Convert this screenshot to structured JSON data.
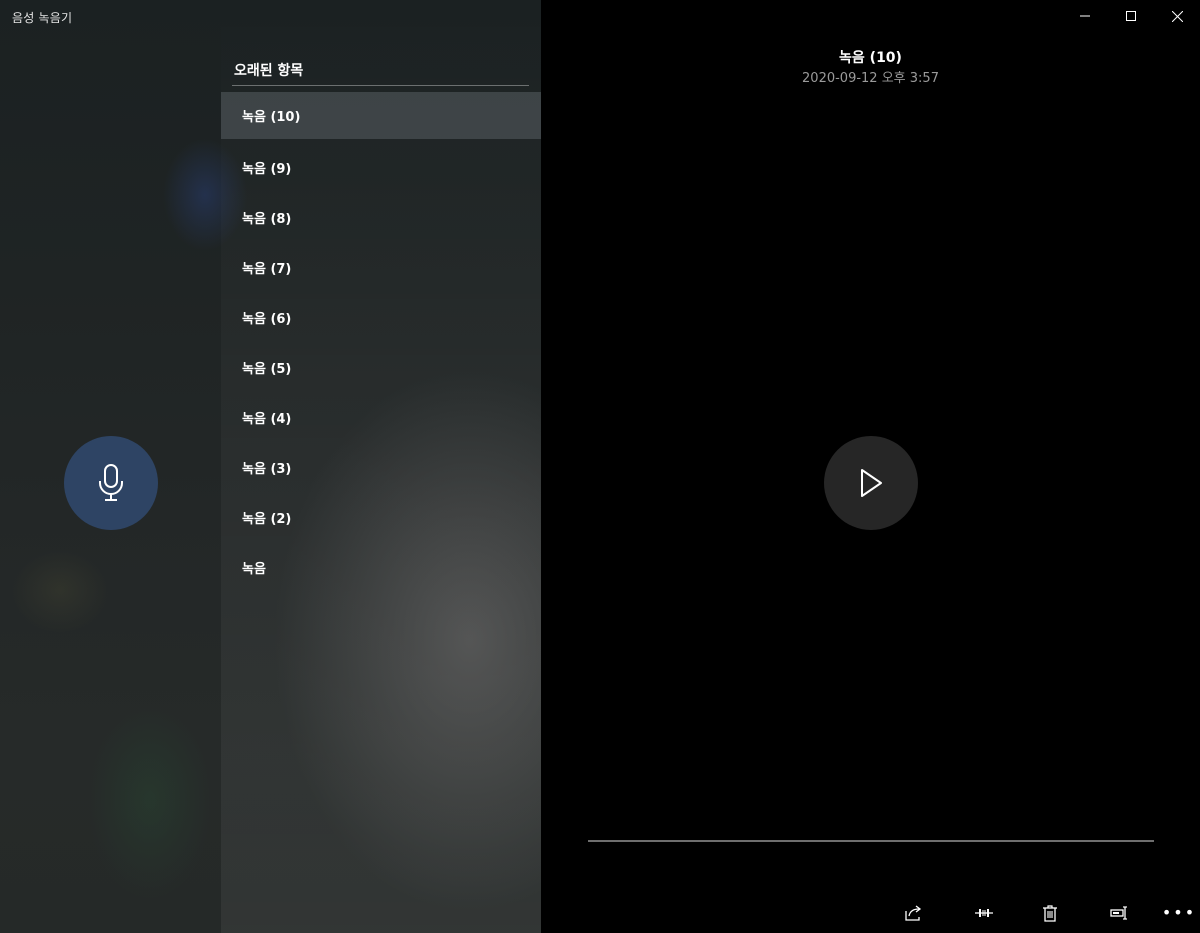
{
  "app": {
    "title": "음성 녹음기"
  },
  "list": {
    "header": "오래된 항목",
    "items": [
      {
        "label": "녹음 (10)",
        "selected": true
      },
      {
        "label": "녹음 (9)"
      },
      {
        "label": "녹음 (8)"
      },
      {
        "label": "녹음 (7)"
      },
      {
        "label": "녹음 (6)"
      },
      {
        "label": "녹음 (5)"
      },
      {
        "label": "녹음 (4)"
      },
      {
        "label": "녹음 (3)"
      },
      {
        "label": "녹음 (2)"
      },
      {
        "label": "녹음"
      }
    ]
  },
  "detail": {
    "title": "녹음 (10)",
    "date": "2020-09-12 오후 3:57"
  },
  "icons": {
    "record": "microphone-icon",
    "play": "play-icon",
    "share": "share-icon",
    "trim": "trim-icon",
    "delete": "delete-icon",
    "rename": "rename-icon",
    "more": "more-icon"
  },
  "colors": {
    "record_button": "#2e4464",
    "play_button": "#262626",
    "selected_item": "#4b5356"
  }
}
